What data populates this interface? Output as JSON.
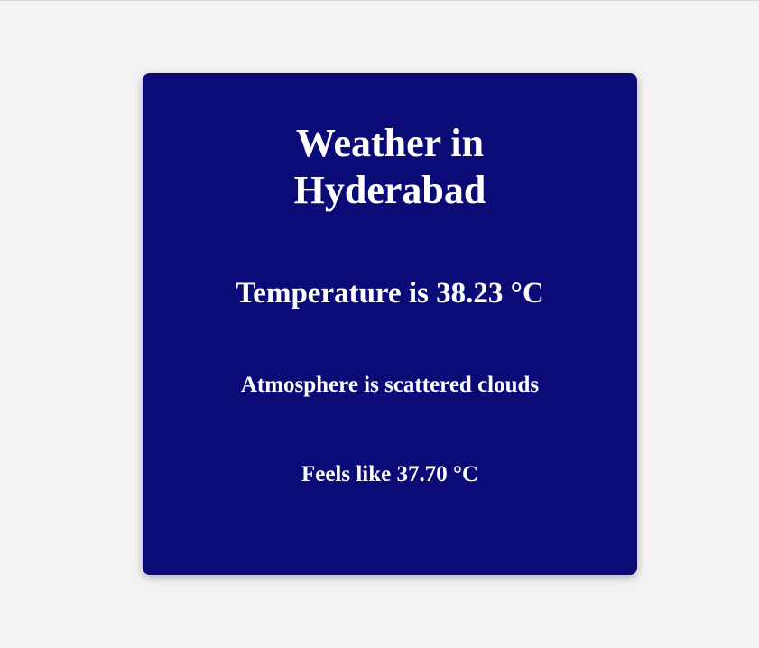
{
  "weather": {
    "title": "Weather in Hyderabad",
    "temperature_text": "Temperature is 38.23 °C",
    "atmosphere_text": "Atmosphere is scattered clouds",
    "feels_like_text": "Feels like 37.70 °C"
  },
  "colors": {
    "background": "#f3f3f3",
    "card": "#0a0b77",
    "text": "#ffffff"
  }
}
